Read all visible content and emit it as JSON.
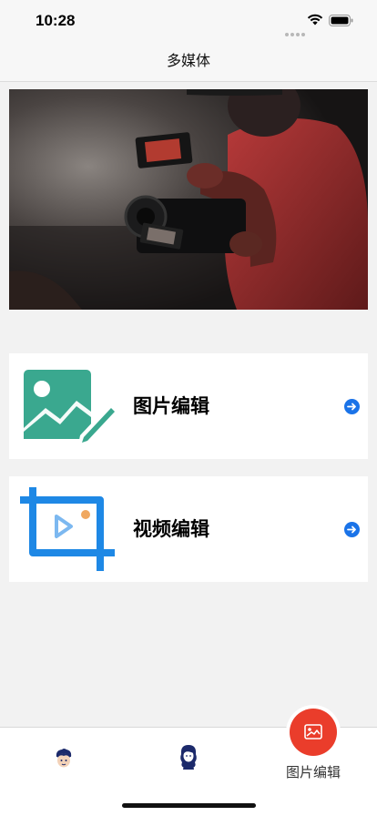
{
  "status_bar": {
    "time": "10:28",
    "icons": [
      "signal-dots-icon",
      "wifi-icon",
      "battery-icon"
    ]
  },
  "nav": {
    "title": "多媒体"
  },
  "hero": {
    "image": "camera-operator-photo"
  },
  "menu": [
    {
      "label": "图片编辑",
      "icon": "image-edit-icon",
      "accent": "#3aa88f",
      "arrow": "arrow-right-circle-icon"
    },
    {
      "label": "视频编辑",
      "icon": "video-edit-icon",
      "accent": "#1e88e5",
      "arrow": "arrow-right-circle-icon"
    }
  ],
  "tab_bar": {
    "tabs": [
      {
        "icon": "boy-avatar-icon"
      },
      {
        "icon": "girl-avatar-icon"
      },
      {
        "icon": "image-icon",
        "label": "图片编辑",
        "active": true
      }
    ],
    "fab_color": "#ea3d2b"
  },
  "colors": {
    "background": "#f2f2f2",
    "arrow": "#1a73e8",
    "icon_navy": "#1c2a6b"
  }
}
